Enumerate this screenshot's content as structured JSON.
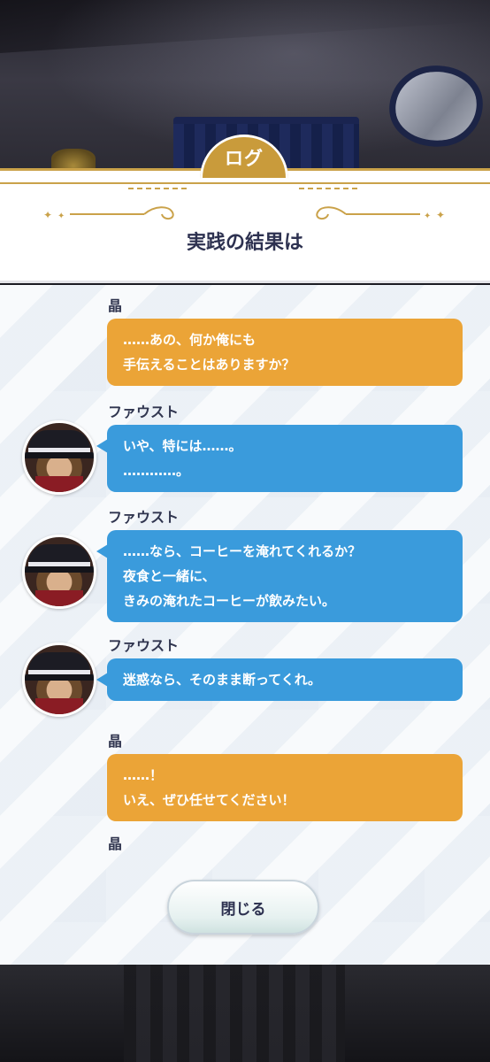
{
  "window": {
    "tab_label": "ログ",
    "title": "実践の結果は"
  },
  "log": [
    {
      "speaker": "晶",
      "kind": "player",
      "lines": [
        "……あの、何か俺にも",
        "手伝えることはありますか？"
      ]
    },
    {
      "speaker": "ファウスト",
      "kind": "npc",
      "lines": [
        "いや、特には……。",
        "…………。"
      ]
    },
    {
      "speaker": "ファウスト",
      "kind": "npc",
      "lines": [
        "……なら、コーヒーを淹れてくれるか？",
        "夜食と一緒に、",
        "きみの淹れたコーヒーが飲みたい。"
      ]
    },
    {
      "speaker": "ファウスト",
      "kind": "npc",
      "lines": [
        "迷惑なら、そのまま断ってくれ。"
      ]
    },
    {
      "speaker": "晶",
      "kind": "player",
      "lines": [
        "……！",
        "いえ、ぜひ任せてください！"
      ]
    },
    {
      "speaker": "晶",
      "kind": "player",
      "lines": []
    }
  ],
  "footer": {
    "close_label": "閉じる"
  },
  "colors": {
    "player_bubble": "#eba437",
    "npc_bubble": "#3a9bdc",
    "gold_accent": "#caa24a"
  },
  "icons": {
    "avatar": "faust-avatar-icon"
  }
}
